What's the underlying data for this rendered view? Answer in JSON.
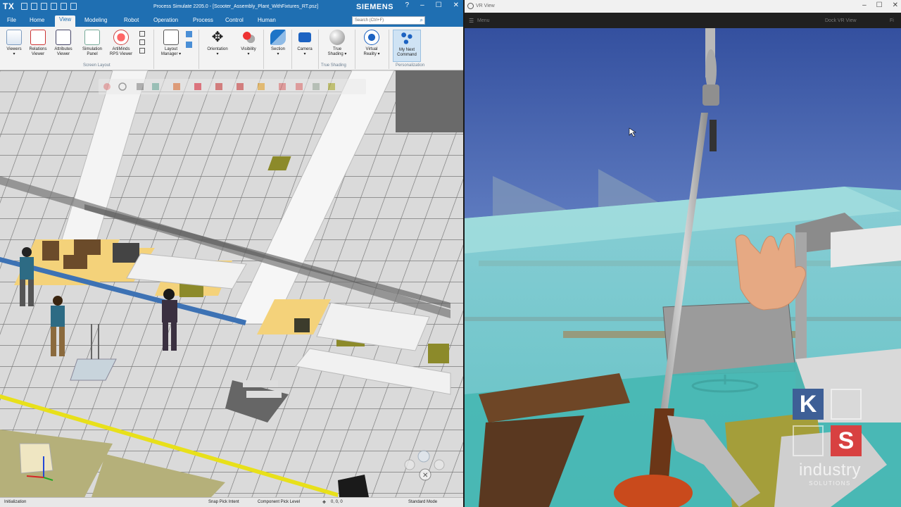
{
  "left_window": {
    "app_logo": "TX",
    "title": "Process Simulate 2205.0 - [Scooter_Assembly_Plant_WithFixtures_RT.psz]",
    "brand": "SIEMENS",
    "window_buttons": [
      "?",
      "–",
      "☐",
      "✕"
    ],
    "menu_tabs": [
      "File",
      "Home",
      "View",
      "Modeling",
      "Robot",
      "Operation",
      "Process",
      "Control",
      "Human"
    ],
    "active_tab": "View",
    "search_placeholder": "Search (Ctrl+F)",
    "ribbon": {
      "buttons": [
        {
          "label": "Viewers",
          "sub": "▾"
        },
        {
          "label": "Relations",
          "sub": "Viewer"
        },
        {
          "label": "Attributes",
          "sub": "Viewer"
        },
        {
          "label": "Simulation",
          "sub": "Panel"
        },
        {
          "label": "ArtiMinds",
          "sub": "RPS Viewer"
        },
        {
          "label": "Layout",
          "sub": "Manager ▾"
        },
        {
          "label": "Orientation",
          "sub": "▾"
        },
        {
          "label": "Visibility",
          "sub": "▾"
        },
        {
          "label": "Section",
          "sub": "▾"
        },
        {
          "label": "Camera",
          "sub": "▾"
        },
        {
          "label": "True",
          "sub": "Shading ▾"
        },
        {
          "label": "Virtual",
          "sub": "Reality ▾"
        },
        {
          "label": "My Next",
          "sub": "Command"
        }
      ],
      "groups": [
        "Screen Layout",
        "True Shading",
        "Personalization"
      ]
    },
    "status": {
      "left": "Initialization",
      "snap": "Snap Pick Intent",
      "pick": "Component Pick Level",
      "coords": "0, 0, 0",
      "mode": "Standard Mode"
    },
    "colors": {
      "accent": "#1f6fb2",
      "floor": "#dcdcdc",
      "grid": "#8a8a8a",
      "table": "#f4d27a"
    }
  },
  "right_window": {
    "title": "VR View",
    "menu": "Menu",
    "dock_label": "Dock VR View",
    "right_label": "Fi",
    "window_buttons": [
      "–",
      "☐",
      "✕"
    ],
    "colors": {
      "sky_top": "#3a55a8",
      "sky_bottom": "#8ea8d6",
      "glass": "#6fd6d2",
      "hand": "#e7ad86"
    }
  },
  "watermark": {
    "letters": [
      "K",
      "S"
    ],
    "text": "industry",
    "sub": "SOLUTIONS"
  }
}
